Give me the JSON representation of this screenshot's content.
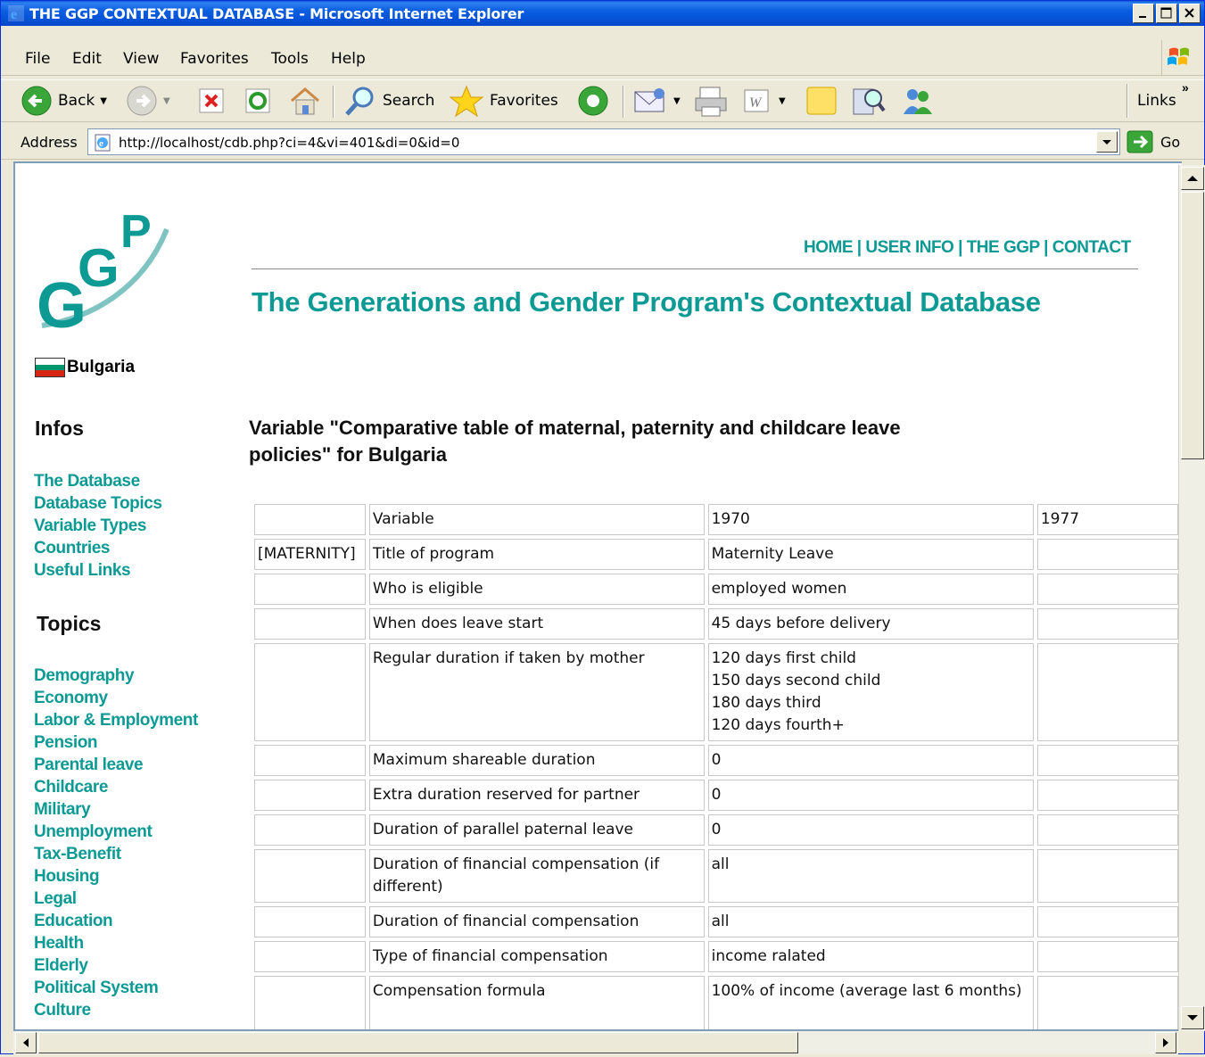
{
  "window": {
    "title": "THE GGP CONTEXTUAL DATABASE - Microsoft Internet Explorer"
  },
  "menu": {
    "items": [
      {
        "label": "File"
      },
      {
        "label": "Edit"
      },
      {
        "label": "View"
      },
      {
        "label": "Favorites"
      },
      {
        "label": "Tools"
      },
      {
        "label": "Help"
      }
    ]
  },
  "toolbar": {
    "back_label": "Back",
    "search_label": "Search",
    "favorites_label": "Favorites",
    "links_label": "Links"
  },
  "address": {
    "label": "Address",
    "url": "http://localhost/cdb.php?ci=4&vi=401&di=0&id=0",
    "go_label": "Go"
  },
  "page": {
    "top_nav": "HOME | USER INFO | THE GGP | CONTACT",
    "title": "The Generations and Gender Program's Contextual Database",
    "country": "Bulgaria",
    "infos_heading": "Infos",
    "infos_links": [
      "The Database",
      "Database Topics",
      "Variable Types",
      "Countries",
      "Useful Links"
    ],
    "topics_heading": "Topics",
    "topics_links": [
      "Demography",
      "Economy",
      "Labor & Employment",
      "Pension",
      "Parental leave",
      "Childcare",
      "Military",
      "Unemployment",
      "Tax-Benefit",
      "Housing",
      "Legal",
      "Education",
      "Health",
      "Elderly",
      "Political System",
      "Culture"
    ],
    "variable_title": "Variable \"Comparative table of maternal, paternity and childcare leave policies\" for Bulgaria",
    "flag_colors": [
      "#ffffff",
      "#00966e",
      "#d62612"
    ]
  },
  "table": {
    "header": [
      "",
      "Variable",
      "1970",
      "1977"
    ],
    "rows": [
      [
        "[MATERNITY]",
        "Title of program",
        "Maternity Leave",
        ""
      ],
      [
        "",
        "Who is eligible",
        "employed women",
        ""
      ],
      [
        "",
        "When does leave start",
        "45 days before delivery",
        ""
      ],
      [
        "",
        "Regular duration if taken by mother",
        "120 days first child\n150 days second child\n180 days third\n120 days fourth+",
        ""
      ],
      [
        "",
        "Maximum shareable duration",
        "0",
        ""
      ],
      [
        "",
        "Extra duration reserved for partner",
        "0",
        ""
      ],
      [
        "",
        "Duration of parallel paternal leave",
        "0",
        ""
      ],
      [
        "",
        "Duration of financial compensation (if different)",
        "all",
        ""
      ],
      [
        "",
        "Duration of financial compensation",
        "all",
        ""
      ],
      [
        "",
        "Type of financial compensation",
        "income ralated",
        ""
      ],
      [
        "",
        "Compensation formula",
        "100% of income (average last 6 months)",
        ""
      ]
    ]
  }
}
